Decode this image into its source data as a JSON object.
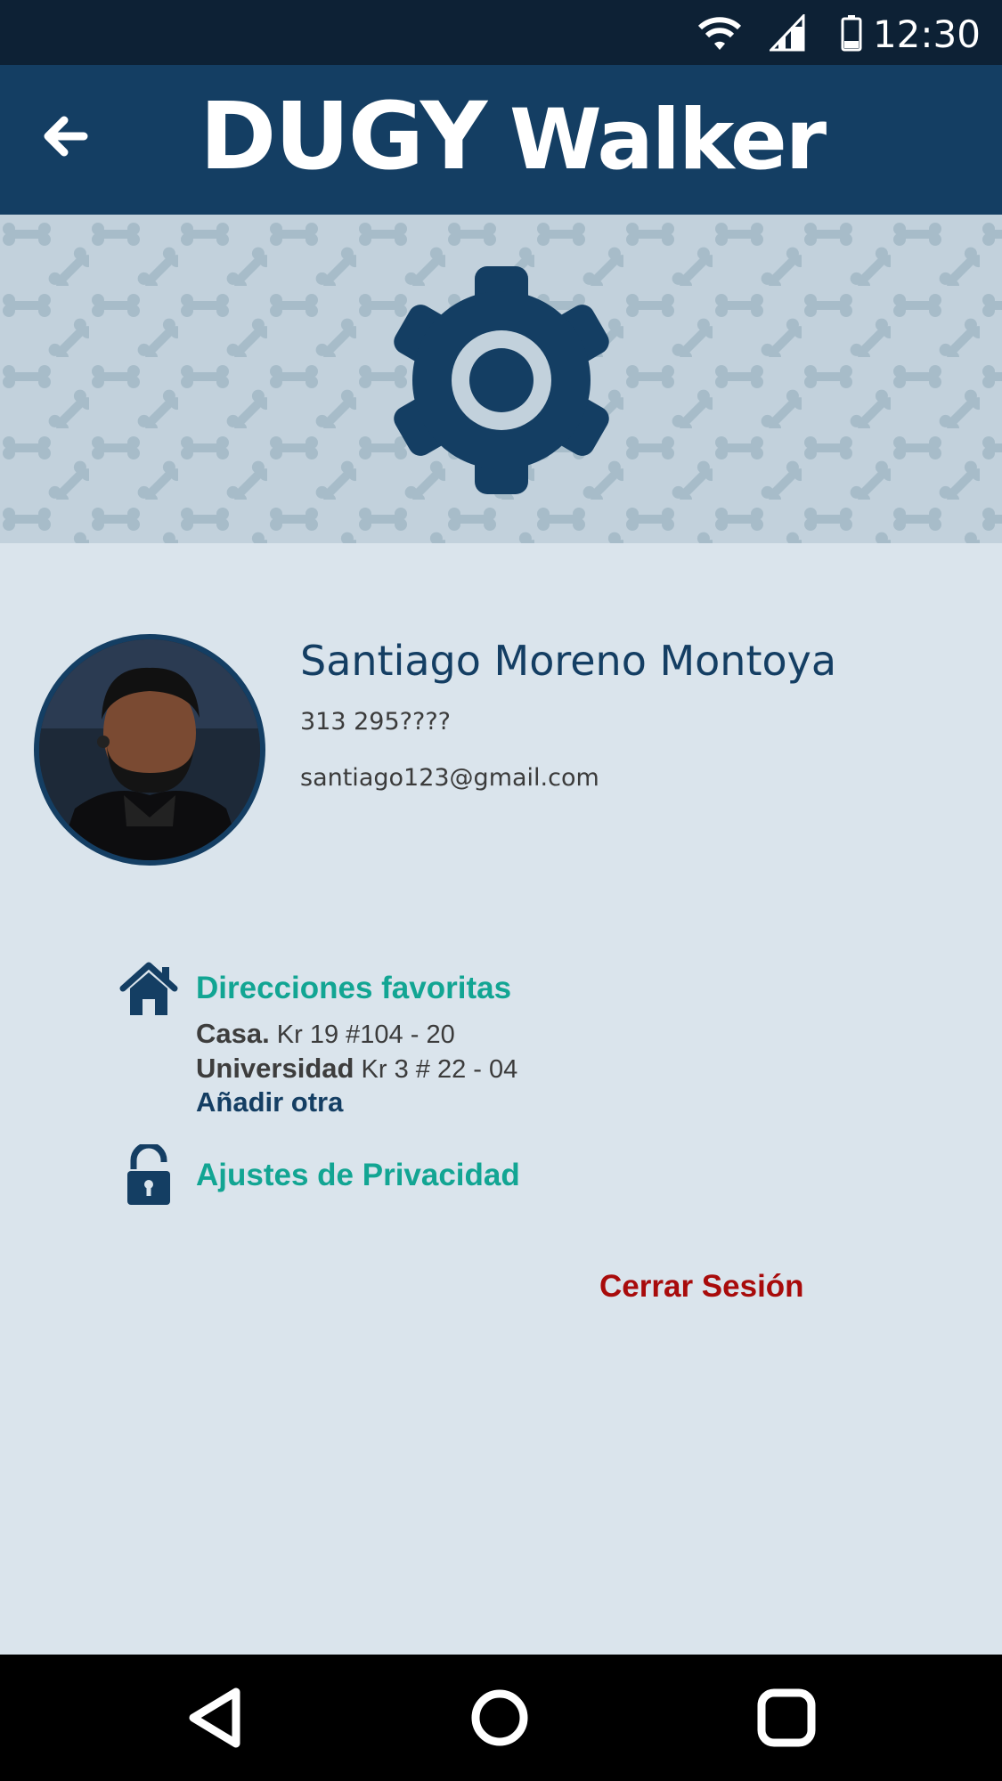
{
  "status_bar": {
    "time": "12:30",
    "icons": [
      "wifi-icon",
      "cellular-signal-icon",
      "battery-icon"
    ]
  },
  "app_bar": {
    "brand_part1": "DUGY",
    "brand_part2": "Walker",
    "back_icon": "arrow-left-icon",
    "color": "#143e63"
  },
  "banner": {
    "icon": "gear-icon",
    "pattern_icon": "bone-icon"
  },
  "profile": {
    "name": "Santiago Moreno Montoya",
    "phone": "313 295????",
    "email": "santiago123@gmail.com",
    "avatar": "user-photo"
  },
  "favorites": {
    "icon": "home-icon",
    "title": "Direcciones favoritas",
    "addresses": [
      {
        "name": "Casa.",
        "address": "Kr 19 #104 - 20"
      },
      {
        "name": "Universidad",
        "address": "Kr 3 # 22 - 04"
      }
    ],
    "add_label": "Añadir otra"
  },
  "privacy": {
    "icon": "lock-icon",
    "title": "Ajustes de Privacidad"
  },
  "logout_label": "Cerrar Sesión",
  "nav_bar": {
    "icons": [
      "back-triangle-icon",
      "home-circle-icon",
      "recents-square-icon"
    ]
  },
  "colors": {
    "primary": "#143e63",
    "accent": "#12a593",
    "danger": "#a80b0b",
    "background": "#dae4ec"
  }
}
